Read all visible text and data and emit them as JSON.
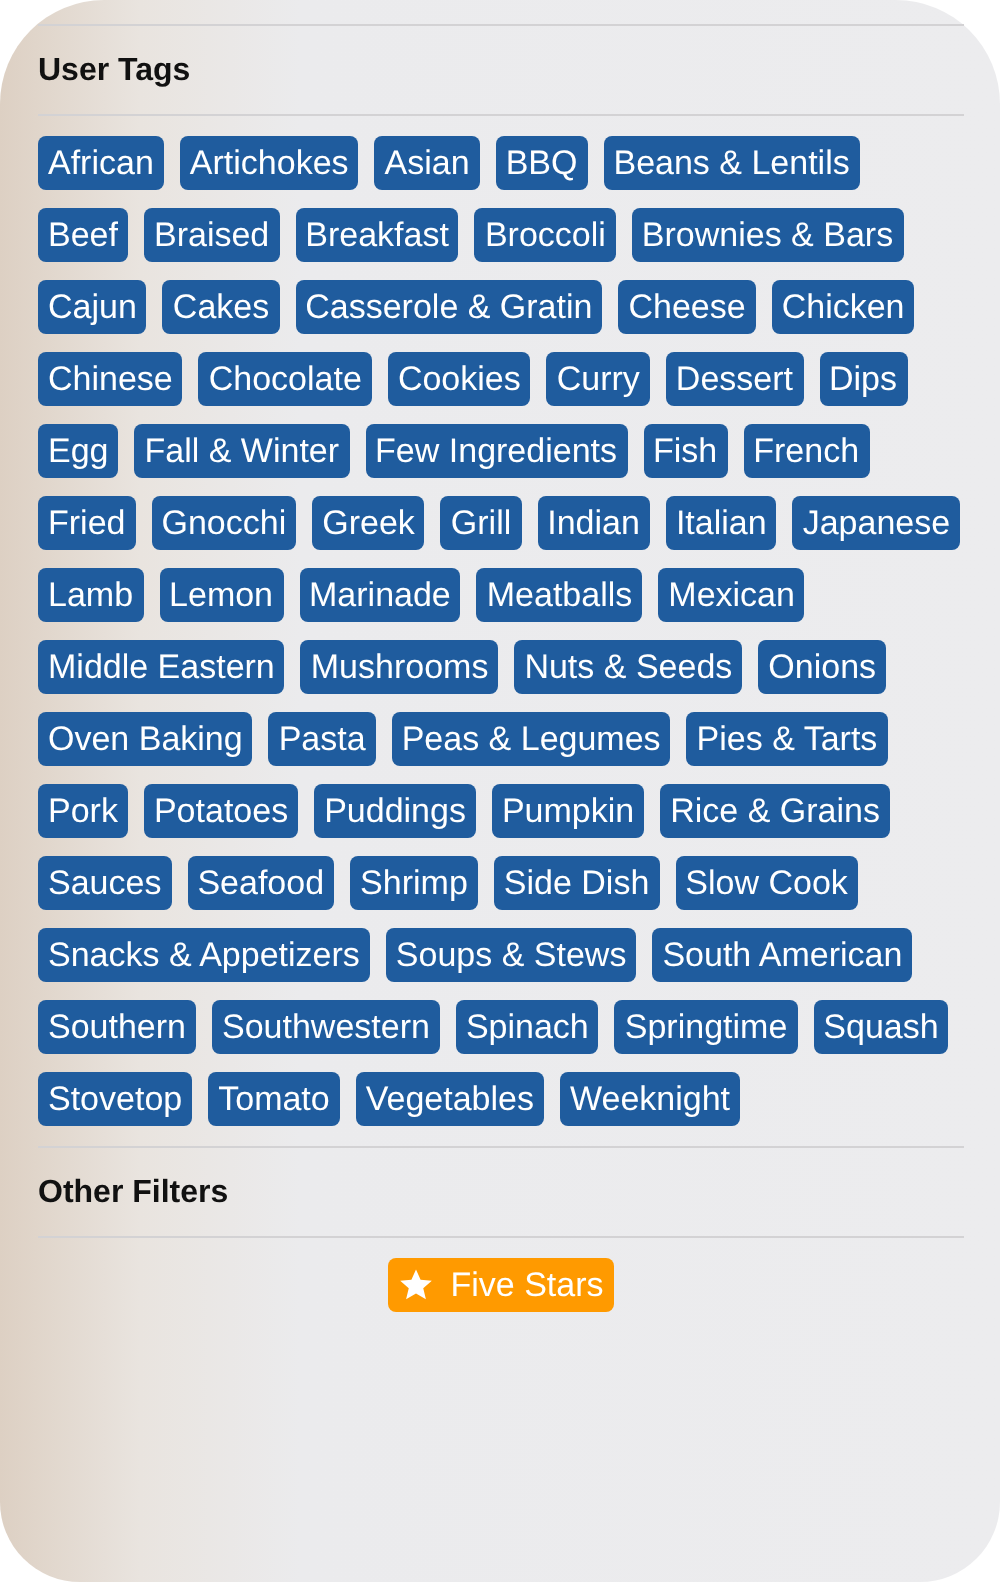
{
  "sections": [
    {
      "title": "User Tags",
      "tags": [
        {
          "label": "African"
        },
        {
          "label": "Artichokes"
        },
        {
          "label": "Asian"
        },
        {
          "label": "BBQ"
        },
        {
          "label": "Beans & Lentils"
        },
        {
          "label": "Beef"
        },
        {
          "label": "Braised"
        },
        {
          "label": "Breakfast"
        },
        {
          "label": "Broccoli"
        },
        {
          "label": "Brownies & Bars"
        },
        {
          "label": "Cajun"
        },
        {
          "label": "Cakes"
        },
        {
          "label": "Casserole & Gratin"
        },
        {
          "label": "Cheese"
        },
        {
          "label": "Chicken"
        },
        {
          "label": "Chinese"
        },
        {
          "label": "Chocolate"
        },
        {
          "label": "Cookies"
        },
        {
          "label": "Curry"
        },
        {
          "label": "Dessert"
        },
        {
          "label": "Dips"
        },
        {
          "label": "Egg"
        },
        {
          "label": "Fall & Winter"
        },
        {
          "label": "Few Ingredients"
        },
        {
          "label": "Fish"
        },
        {
          "label": "French"
        },
        {
          "label": "Fried"
        },
        {
          "label": "Gnocchi"
        },
        {
          "label": "Greek"
        },
        {
          "label": "Grill"
        },
        {
          "label": "Indian"
        },
        {
          "label": "Italian"
        },
        {
          "label": "Japanese"
        },
        {
          "label": "Lamb"
        },
        {
          "label": "Lemon"
        },
        {
          "label": "Marinade"
        },
        {
          "label": "Meatballs"
        },
        {
          "label": "Mexican"
        },
        {
          "label": "Middle Eastern"
        },
        {
          "label": "Mushrooms"
        },
        {
          "label": "Nuts & Seeds"
        },
        {
          "label": "Onions"
        },
        {
          "label": "Oven Baking"
        },
        {
          "label": "Pasta"
        },
        {
          "label": "Peas & Legumes"
        },
        {
          "label": "Pies & Tarts"
        },
        {
          "label": "Pork"
        },
        {
          "label": "Potatoes"
        },
        {
          "label": "Puddings"
        },
        {
          "label": "Pumpkin"
        },
        {
          "label": "Rice & Grains"
        },
        {
          "label": "Sauces"
        },
        {
          "label": "Seafood"
        },
        {
          "label": "Shrimp"
        },
        {
          "label": "Side Dish"
        },
        {
          "label": "Slow Cook"
        },
        {
          "label": "Snacks & Appetizers"
        },
        {
          "label": "Soups & Stews"
        },
        {
          "label": "South American"
        },
        {
          "label": "Southern"
        },
        {
          "label": "Southwestern"
        },
        {
          "label": "Spinach"
        },
        {
          "label": "Springtime"
        },
        {
          "label": "Squash"
        },
        {
          "label": "Stovetop"
        },
        {
          "label": "Tomato"
        },
        {
          "label": "Vegetables"
        },
        {
          "label": "Weeknight"
        }
      ]
    },
    {
      "title": "Other Filters",
      "tags": [
        {
          "label": "Five Stars",
          "kind": "rating",
          "color": "#ff9a00"
        }
      ]
    }
  ]
}
